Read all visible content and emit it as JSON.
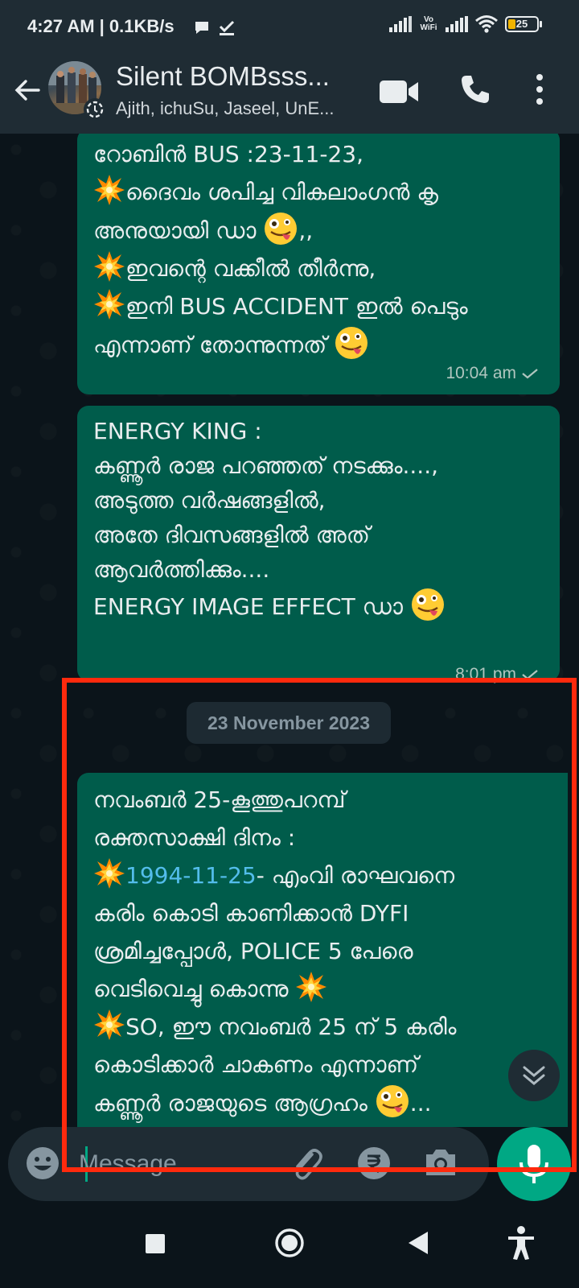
{
  "status_bar": {
    "time": "4:27 AM | 0.1KB/s",
    "vowifi": "Vo WiFi",
    "battery": "25"
  },
  "header": {
    "title": "Silent BOMBsss...",
    "members": "Ajith, ichuSu, Jaseel, UnE..."
  },
  "messages": [
    {
      "lines": [
        [
          {
            "t": "text",
            "v": "റോബിൻ BUS :23-11-23,"
          }
        ],
        [
          {
            "t": "blast"
          },
          {
            "t": "text",
            "v": "ദൈവം ശപിച്ച വികലാംഗൻ കൃ"
          }
        ],
        [
          {
            "t": "text",
            "v": "അനുയായി ഡാ "
          },
          {
            "t": "face"
          },
          {
            "t": "text",
            "v": ",,"
          }
        ],
        [
          {
            "t": "blast"
          },
          {
            "t": "text",
            "v": "ഇവന്റെ വക്കീൽ തീർന്നു,"
          }
        ],
        [
          {
            "t": "blast"
          },
          {
            "t": "text",
            "v": "ഇനി BUS ACCIDENT ഇൽ പെടും"
          }
        ],
        [
          {
            "t": "text",
            "v": "എന്നാണ് തോന്നുന്നത് "
          },
          {
            "t": "face"
          }
        ]
      ],
      "time": "10:04 am"
    },
    {
      "lines": [
        [
          {
            "t": "text",
            "v": "ENERGY KING :"
          }
        ],
        [
          {
            "t": "text",
            "v": "കണ്ണൂർ രാജ പറഞ്ഞത് നടക്കും....,"
          }
        ],
        [
          {
            "t": "text",
            "v": "അടുത്ത വർഷങ്ങളിൽ,"
          }
        ],
        [
          {
            "t": "text",
            "v": "അതേ ദിവസങ്ങളിൽ അത്"
          }
        ],
        [
          {
            "t": "text",
            "v": "ആവർത്തിക്കും...."
          }
        ],
        [
          {
            "t": "text",
            "v": " "
          }
        ],
        [
          {
            "t": "text",
            "v": "ENERGY IMAGE EFFECT ഡാ "
          },
          {
            "t": "face"
          }
        ]
      ],
      "time": "8:01 pm"
    },
    {
      "lines": [
        [
          {
            "t": "text",
            "v": "നവംബർ 25-കൂത്തുപറമ്പ്"
          }
        ],
        [
          {
            "t": "text",
            "v": "രക്തസാക്ഷി ദിനം :"
          }
        ],
        [
          {
            "t": "blast"
          },
          {
            "t": "link",
            "v": "1994-11-25"
          },
          {
            "t": "text",
            "v": "- എംവി രാഘവനെ"
          }
        ],
        [
          {
            "t": "text",
            "v": "കരിം കൊടി കാണിക്കാൻ DYFI"
          }
        ],
        [
          {
            "t": "text",
            "v": "ശ്രമിച്ചപ്പോൾ, POLICE 5 പേരെ"
          }
        ],
        [
          {
            "t": "text",
            "v": "വെടിവെച്ചു കൊന്നു "
          },
          {
            "t": "blast"
          }
        ],
        [
          {
            "t": "blast"
          },
          {
            "t": "text",
            "v": "SO, ഈ നവംബർ 25 ന് 5 കരിം"
          }
        ],
        [
          {
            "t": "text",
            "v": "കൊടിക്കാർ ചാകണം എന്നാണ്"
          }
        ],
        [
          {
            "t": "text",
            "v": "കണ്ണൂർ രാജയുടെ ആഗ്രഹം "
          },
          {
            "t": "face"
          },
          {
            "t": "text",
            "v": "..."
          }
        ]
      ],
      "time": ""
    }
  ],
  "date_chip": "23 November 2023",
  "input": {
    "placeholder": "Message"
  },
  "colors": {
    "bubble": "#005c4b",
    "accent": "#00a884",
    "highlight_frame": "#ff2a0d",
    "link": "#53bdeb"
  },
  "icons": [
    "back-arrow-icon",
    "video-call-icon",
    "phone-icon",
    "more-options-icon",
    "emoji-icon",
    "attach-icon",
    "rupee-payment-icon",
    "camera-icon",
    "mic-icon",
    "chevron-double-down-icon",
    "recent-apps-icon",
    "home-icon",
    "back-nav-icon",
    "accessibility-icon"
  ]
}
